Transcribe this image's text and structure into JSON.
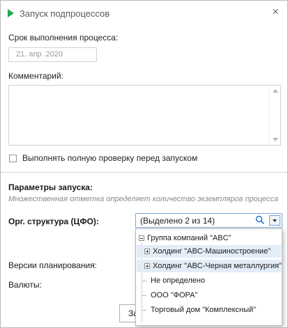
{
  "window": {
    "title": "Запуск подпроцессов",
    "close_glyph": "×"
  },
  "form": {
    "deadline_label": "Срок выполнения процесса:",
    "deadline_value": "21. апр .2020",
    "comment_label": "Комментарий:",
    "comment_value": "",
    "full_check_label": "Выполнять полную проверку перед запуском",
    "full_check_checked": false
  },
  "params": {
    "title": "Параметры запуска:",
    "hint": "Множественная отметка определяет количество экземпляров процесса",
    "org_label": "Орг. структура (ЦФО):",
    "org_value": "(Выделено 2 из 14)",
    "versions_label": "Версии планирования:",
    "currencies_label": "Валюты:"
  },
  "tree": {
    "items": [
      {
        "label": "Группа компаний \"ABC\"",
        "expander": "minus",
        "selected": false
      },
      {
        "label": "Холдинг \"ABC-Машиностроение\"",
        "expander": "plus",
        "selected": true
      },
      {
        "label": "Холдинг \"ABC-Черная металлургия\"",
        "expander": "plus",
        "selected": true
      },
      {
        "label": "Не определено",
        "expander": "none",
        "selected": false
      },
      {
        "label": "ООО \"ФОРА\"",
        "expander": "none",
        "selected": false
      },
      {
        "label": "Торговый дом \"Комплексный\"",
        "expander": "none",
        "selected": false
      }
    ]
  },
  "footer": {
    "button_label": "За"
  },
  "icons": {
    "title_icon": "play-icon",
    "search_icon": "search-icon",
    "dropdown_icon": "chevron-down-icon"
  },
  "colors": {
    "accent_green": "#1fa84f",
    "selection": "#e2edf8",
    "focus_border": "#7ca7d4",
    "search_icon": "#2a7fd4"
  }
}
